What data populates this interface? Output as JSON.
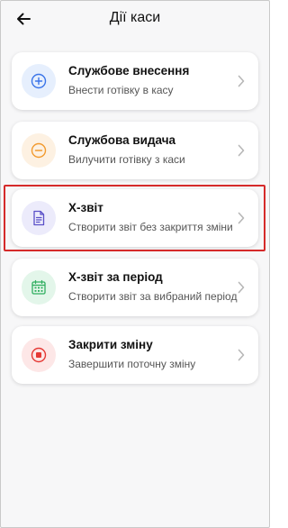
{
  "header": {
    "title": "Дії каси",
    "back_icon": "arrow-left-icon"
  },
  "actions": [
    {
      "label": "Службове внесення",
      "subtitle": "Внести готівку в касу",
      "icon": "plus-circle-icon",
      "icon_color": "#3a74e8",
      "icon_bg": "#e6effd"
    },
    {
      "label": "Службова видача",
      "subtitle": "Вилучити готівку з каси",
      "icon": "minus-circle-icon",
      "icon_color": "#f29a2e",
      "icon_bg": "#fdf1e2"
    },
    {
      "label": "Х-звіт",
      "subtitle": "Створити звіт без закриття зміни",
      "icon": "document-icon",
      "icon_color": "#5a50c8",
      "icon_bg": "#ecebfb"
    },
    {
      "label": "Х-звіт за період",
      "subtitle": "Створити звіт за вибраний період",
      "icon": "calendar-icon",
      "icon_color": "#2fae5f",
      "icon_bg": "#e3f6ea"
    },
    {
      "label": "Закрити зміну",
      "subtitle": "Завершити поточну зміну",
      "icon": "stop-circle-icon",
      "icon_color": "#e53935",
      "icon_bg": "#fde7e7"
    }
  ],
  "highlight_color": "#d52a2a"
}
